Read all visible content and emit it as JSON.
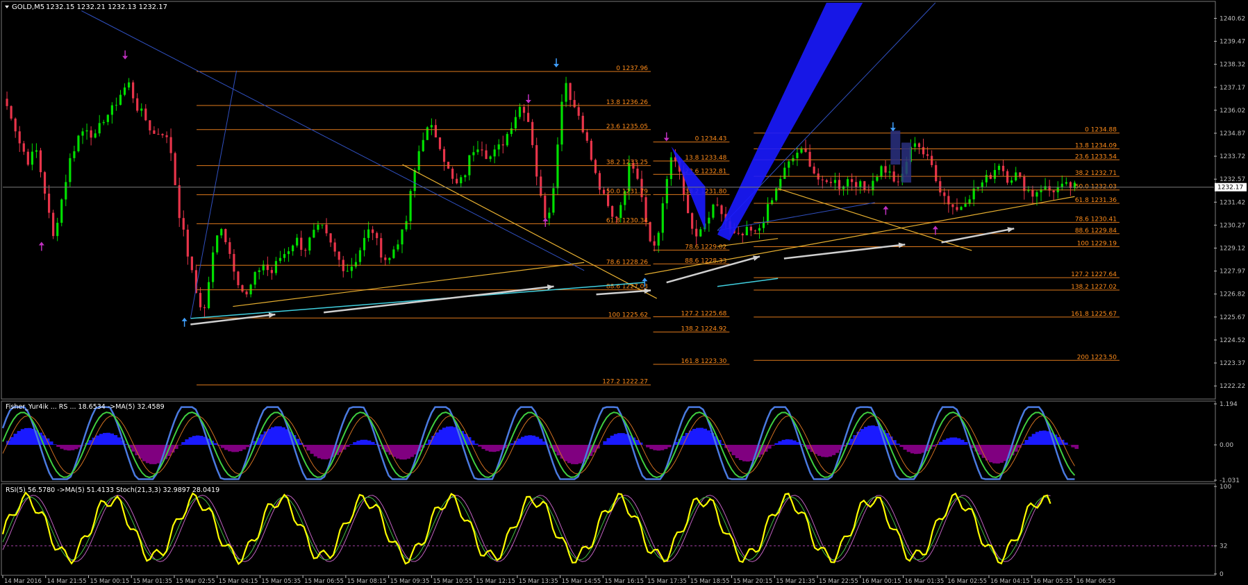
{
  "chart_data": {
    "type": "line",
    "symbol_header": {
      "symbol": "GOLD,M5",
      "ohlc": "1232.15 1232.21 1232.13 1232.17"
    },
    "price_panel": {
      "ylim": [
        1221.6,
        1241.4
      ],
      "current_price": "1232.17",
      "y_ticks": [
        "1240.62",
        "1239.47",
        "1238.32",
        "1237.17",
        "1236.02",
        "1234.87",
        "1233.72",
        "1232.57",
        "1231.42",
        "1230.27",
        "1229.12",
        "1227.97",
        "1226.82",
        "1225.67",
        "1224.52",
        "1223.37",
        "1222.22"
      ],
      "series": [
        {
          "values": [
            1236.6,
            1235.8,
            1234.4,
            1233.5,
            1234.0,
            1232.0,
            1229.6,
            1231.5,
            1233.5,
            1234.7,
            1235.2,
            1234.6,
            1235.6,
            1236.0,
            1236.8,
            1237.4,
            1236.2,
            1235.6,
            1234.8,
            1235.0,
            1234.2,
            1231.0,
            1229.0,
            1227.0,
            1225.8,
            1228.6,
            1230.4,
            1229.0,
            1227.6,
            1226.6,
            1227.6,
            1228.4,
            1227.8,
            1228.6,
            1229.0,
            1229.6,
            1229.0,
            1229.8,
            1230.2,
            1229.4,
            1228.6,
            1228.0,
            1228.4,
            1229.4,
            1230.2,
            1229.0,
            1228.4,
            1229.4,
            1230.0,
            1232.6,
            1234.6,
            1235.2,
            1234.6,
            1233.2,
            1232.2,
            1232.6,
            1234.0,
            1234.4,
            1233.6,
            1234.0,
            1234.6,
            1235.6,
            1236.4,
            1235.2,
            1232.0,
            1230.4,
            1233.0,
            1237.8,
            1236.4,
            1235.6,
            1234.0,
            1232.4,
            1231.4,
            1230.4,
            1231.6,
            1233.6,
            1232.6,
            1230.0,
            1229.0,
            1232.0,
            1233.8,
            1232.8,
            1230.2,
            1229.6,
            1230.4,
            1231.2,
            1230.8,
            1229.8,
            1229.6,
            1230.0,
            1229.8,
            1230.8,
            1231.6,
            1232.8,
            1233.4,
            1234.0,
            1233.8,
            1232.8,
            1232.2,
            1232.6,
            1232.2,
            1232.6,
            1232.4,
            1232.0,
            1232.6,
            1233.2,
            1232.8,
            1232.2,
            1233.6,
            1234.6,
            1233.8,
            1233.2,
            1232.0,
            1231.4,
            1231.0,
            1231.6,
            1232.0,
            1232.4,
            1232.8,
            1233.4,
            1232.6,
            1232.8,
            1232.2,
            1231.8,
            1232.2,
            1232.0,
            1232.1,
            1232.2,
            1232.17
          ]
        }
      ],
      "fib_labels": [
        {
          "label": "0 1237.96",
          "price": 1237.96,
          "x0": 0.16,
          "x1": 0.535
        },
        {
          "label": "13.8 1236.26",
          "price": 1236.26,
          "x0": 0.16,
          "x1": 0.535
        },
        {
          "label": "23.6 1235.05",
          "price": 1235.05,
          "x0": 0.16,
          "x1": 0.535
        },
        {
          "label": "38.2 1233.25",
          "price": 1233.25,
          "x0": 0.16,
          "x1": 0.535
        },
        {
          "label": "50.0 1231.79",
          "price": 1231.79,
          "x0": 0.16,
          "x1": 0.535
        },
        {
          "label": "61.8 1230.34",
          "price": 1230.34,
          "x0": 0.16,
          "x1": 0.535
        },
        {
          "label": "78.6 1228.26",
          "price": 1228.26,
          "x0": 0.16,
          "x1": 0.535
        },
        {
          "label": "88.6 1227.03",
          "price": 1227.03,
          "x0": 0.16,
          "x1": 0.535
        },
        {
          "label": "100 1225.62",
          "price": 1225.62,
          "x0": 0.16,
          "x1": 0.535
        },
        {
          "label": "127.2 1222.27",
          "price": 1222.27,
          "x0": 0.16,
          "x1": 0.535
        },
        {
          "label": "0 1234.43",
          "price": 1234.43,
          "x0": 0.537,
          "x1": 0.6
        },
        {
          "label": "13.8 1233.48",
          "price": 1233.48,
          "x0": 0.537,
          "x1": 0.6
        },
        {
          "label": "23.6 1232.81",
          "price": 1232.81,
          "x0": 0.537,
          "x1": 0.6
        },
        {
          "label": "38.2 1231.80",
          "price": 1231.8,
          "x0": 0.537,
          "x1": 0.6
        },
        {
          "label": "78.6 1229.02",
          "price": 1229.02,
          "x0": 0.537,
          "x1": 0.6
        },
        {
          "label": "88.6 1228.33",
          "price": 1228.33,
          "x0": 0.537,
          "x1": 0.6
        },
        {
          "label": "127.2 1225.68",
          "price": 1225.68,
          "x0": 0.537,
          "x1": 0.6
        },
        {
          "label": "138.2 1224.92",
          "price": 1224.92,
          "x0": 0.537,
          "x1": 0.6
        },
        {
          "label": "161.8 1223.30",
          "price": 1223.3,
          "x0": 0.537,
          "x1": 0.6
        },
        {
          "label": "0 1234.88",
          "price": 1234.88,
          "x0": 0.62,
          "x1": 0.922
        },
        {
          "label": "13.8 1234.09",
          "price": 1234.09,
          "x0": 0.62,
          "x1": 0.922
        },
        {
          "label": "23.6 1233.54",
          "price": 1233.54,
          "x0": 0.62,
          "x1": 0.922
        },
        {
          "label": "38.2 1232.71",
          "price": 1232.71,
          "x0": 0.62,
          "x1": 0.922
        },
        {
          "label": "50.0 1232.03",
          "price": 1232.03,
          "x0": 0.62,
          "x1": 0.922
        },
        {
          "label": "61.8 1231.36",
          "price": 1231.36,
          "x0": 0.62,
          "x1": 0.922
        },
        {
          "label": "78.6 1230.41",
          "price": 1230.41,
          "x0": 0.62,
          "x1": 0.922
        },
        {
          "label": "88.6 1229.84",
          "price": 1229.84,
          "x0": 0.62,
          "x1": 0.922
        },
        {
          "label": "100 1229.19",
          "price": 1229.19,
          "x0": 0.62,
          "x1": 0.922
        },
        {
          "label": "127.2 1227.64",
          "price": 1227.64,
          "x0": 0.62,
          "x1": 0.922
        },
        {
          "label": "138.2 1227.02",
          "price": 1227.02,
          "x0": 0.62,
          "x1": 0.922
        },
        {
          "label": "161.8 1225.67",
          "price": 1225.67,
          "x0": 0.62,
          "x1": 0.922
        },
        {
          "label": "200 1223.50",
          "price": 1223.5,
          "x0": 0.62,
          "x1": 0.922
        }
      ]
    },
    "fisher_panel": {
      "header": "Fisher_Yur4ik ... RS ... 18.6534 ->MA(5) 32.4589",
      "ylim": [
        -1.031,
        1.194
      ],
      "y_ticks": [
        "1.194",
        "0.00",
        "-1.031"
      ]
    },
    "rsi_panel": {
      "header": "RSI(5) 56.5780 ->MA(5) 51.4133 Stoch(21,3,3) 32.9897 28.0419",
      "ylim": [
        0,
        100
      ],
      "y_ticks": [
        "100",
        "32",
        "0"
      ]
    },
    "x_ticks": [
      "14 Mar 2016",
      "14 Mar 21:55",
      "15 Mar 00:15",
      "15 Mar 01:35",
      "15 Mar 02:55",
      "15 Mar 04:15",
      "15 Mar 05:35",
      "15 Mar 06:55",
      "15 Mar 08:15",
      "15 Mar 09:35",
      "15 Mar 10:55",
      "15 Mar 12:15",
      "15 Mar 13:35",
      "15 Mar 14:55",
      "15 Mar 16:15",
      "15 Mar 17:35",
      "15 Mar 18:55",
      "15 Mar 20:15",
      "15 Mar 21:35",
      "15 Mar 22:55",
      "16 Mar 00:15",
      "16 Mar 01:35",
      "16 Mar 02:55",
      "16 Mar 04:15",
      "16 Mar 05:35",
      "16 Mar 06:55"
    ],
    "colors": {
      "bull": "#00e000",
      "bear": "#e8344a",
      "fib": "#e07a1c",
      "fib_text": "#ff8c1a",
      "trend_yellow": "#e8b030",
      "cyan": "#40d0e0",
      "blue_band": "#1a1aff",
      "blue_line": "#3050c0",
      "arrow_grey": "#d0d0d0",
      "magenta_arrow": "#c030c0",
      "fisher_pos": "#1a1aff",
      "fisher_neg": "#800080",
      "fisher_line_blue": "#4a7ae0",
      "fisher_line_green": "#40d040",
      "rsi_yellow": "#ffff00",
      "axis": "#c0c0c0"
    }
  }
}
